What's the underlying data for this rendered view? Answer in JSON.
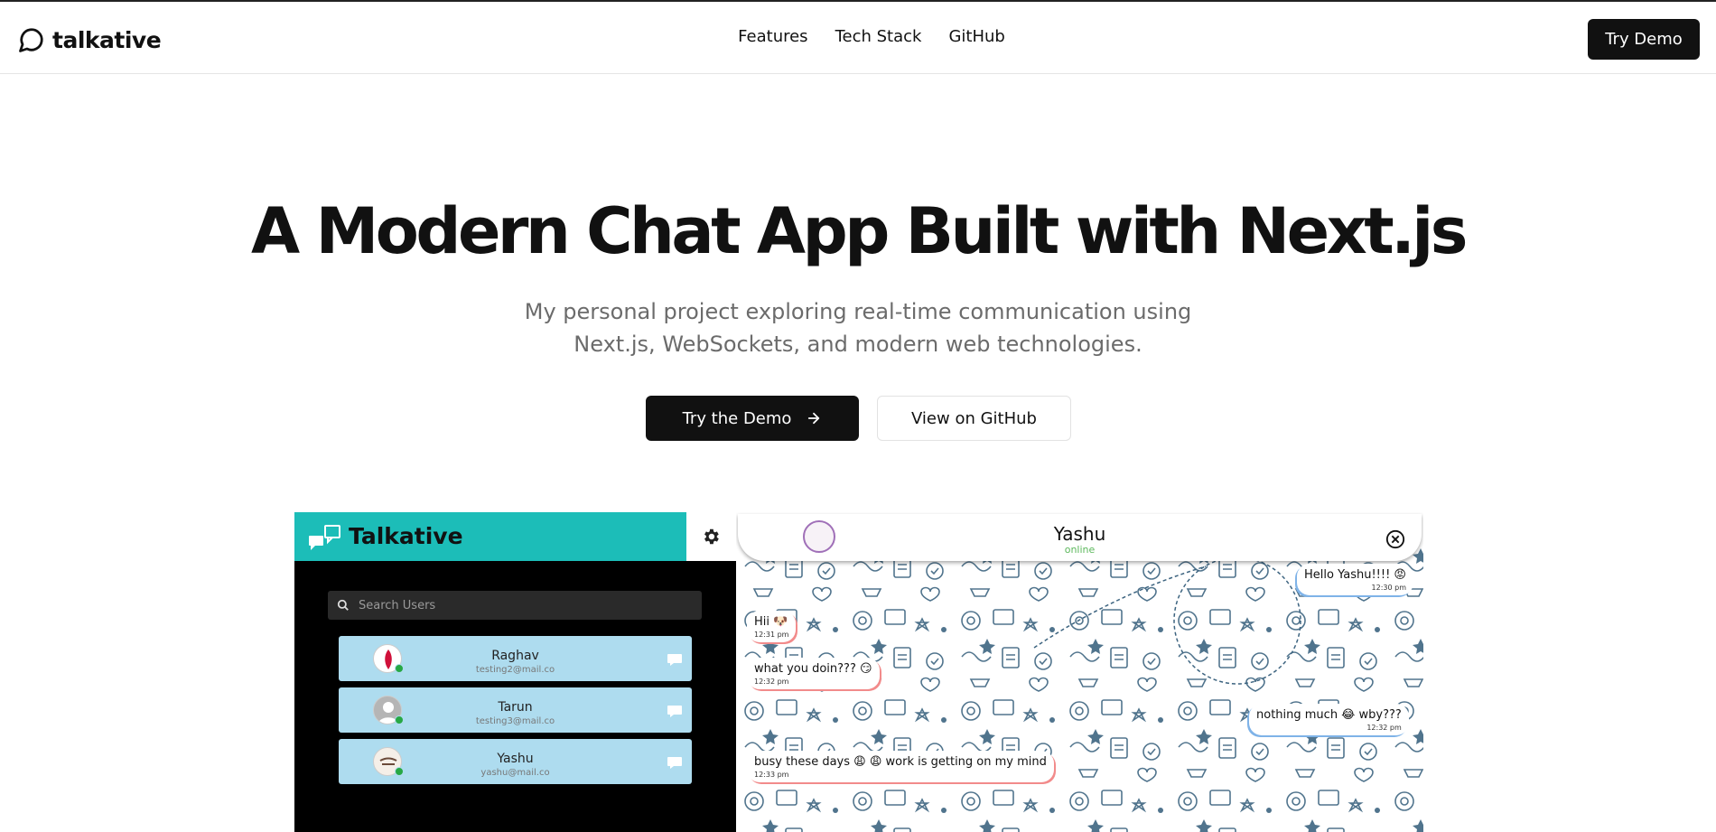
{
  "brand": {
    "name": "talkative",
    "icon": "chat-bubble-icon"
  },
  "nav": {
    "links": [
      "Features",
      "Tech Stack",
      "GitHub"
    ],
    "cta_label": "Try Demo"
  },
  "hero": {
    "title": "A Modern Chat App Built with Next.js",
    "subtitle_line1": "My personal project exploring real-time communication using",
    "subtitle_line2": "Next.js, WebSockets, and modern web technologies.",
    "primary_label": "Try the Demo",
    "secondary_label": "View on GitHub"
  },
  "preview": {
    "app_title": "Talkative",
    "search_placeholder": "Search Users",
    "users": [
      {
        "name": "Raghav",
        "email": "testing2@mail.co"
      },
      {
        "name": "Tarun",
        "email": "testing3@mail.co"
      },
      {
        "name": "Yashu",
        "email": "yashu@mail.co"
      }
    ],
    "chat": {
      "contact_name": "Yashu",
      "status": "online",
      "messages": [
        {
          "text": "Hello Yashu!!!! 😡",
          "time": "12:30 pm",
          "direction": "out"
        },
        {
          "text": "Hii 🐶",
          "time": "12:31 pm",
          "direction": "in"
        },
        {
          "text": "what you doin??? 😏",
          "time": "12:32 pm",
          "direction": "in"
        },
        {
          "text": "nothing much 😂 wby???",
          "time": "12:32 pm",
          "direction": "out"
        },
        {
          "text": "busy these days 😩 😩 work is getting on my mind",
          "time": "12:33 pm",
          "direction": "in"
        }
      ]
    }
  },
  "colors": {
    "accent_teal": "#1cbdb8",
    "user_card": "#aedcef",
    "online_green": "#27a844",
    "dark": "#111111"
  }
}
